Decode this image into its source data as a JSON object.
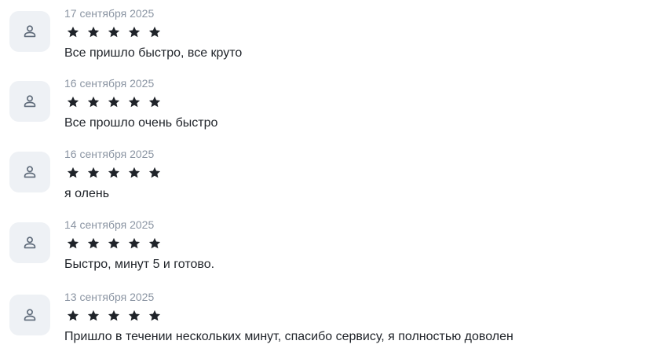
{
  "reviews": [
    {
      "date": "17 сентября 2025",
      "rating": 5,
      "text": "Все пришло быстро, все круто",
      "avatar_icon": "user-icon"
    },
    {
      "date": "16 сентября 2025",
      "rating": 5,
      "text": "Все прошло очень быстро",
      "avatar_icon": "user-icon"
    },
    {
      "date": "16 сентября 2025",
      "rating": 5,
      "text": "я олень",
      "avatar_icon": "user-icon"
    },
    {
      "date": "14 сентября 2025",
      "rating": 5,
      "text": "Быстро, минут 5 и готово.",
      "avatar_icon": "user-icon"
    },
    {
      "date": "13 сентября 2025",
      "rating": 5,
      "text": "Пришло в течении нескольких минут, спасибо сервису, я полностью доволен",
      "avatar_icon": "user-icon"
    }
  ],
  "colors": {
    "avatar_bg": "#eef1f5",
    "avatar_icon": "#5f6b7a",
    "date_text": "#8b95a3",
    "star": "#1f2329",
    "body_text": "#1f2329"
  }
}
